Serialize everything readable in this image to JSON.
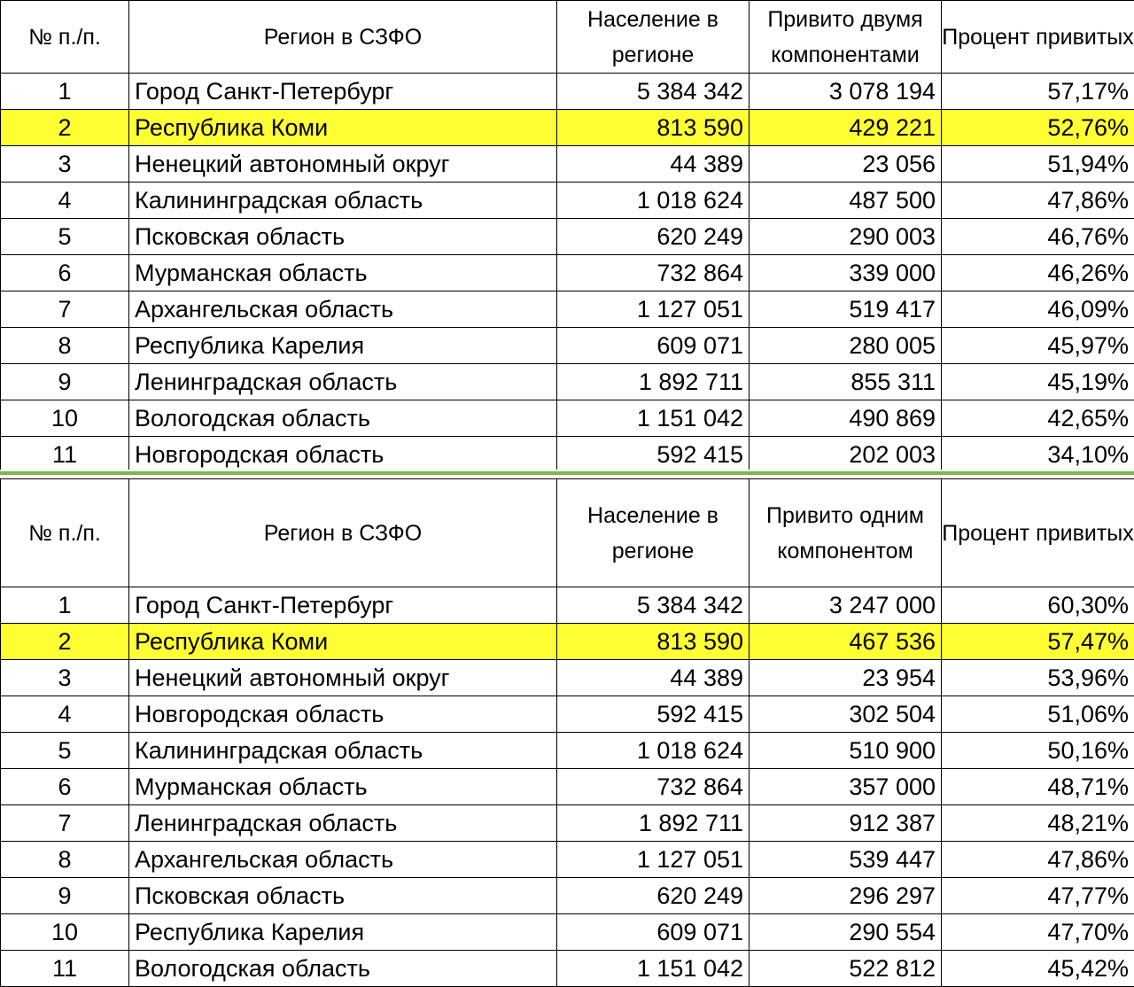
{
  "accent_highlight": "#ffff33",
  "divider_color": "#79b94a",
  "table_two_components": {
    "headers": {
      "num": "№ п./п.",
      "region": "Регион в СЗФО",
      "population": "Население в регионе",
      "vaccinated": "Привито двумя компонентами",
      "percent": "Процент привитых"
    },
    "rows": [
      {
        "num": "1",
        "region": "Город Санкт-Петербург",
        "population": "5 384 342",
        "vaccinated": "3 078 194",
        "percent": "57,17%"
      },
      {
        "num": "2",
        "region": "Республика Коми",
        "population": "813 590",
        "vaccinated": "429 221",
        "percent": "52,76%"
      },
      {
        "num": "3",
        "region": "Ненецкий автономный округ",
        "population": "44 389",
        "vaccinated": "23 056",
        "percent": "51,94%"
      },
      {
        "num": "4",
        "region": "Калининградская область",
        "population": "1 018 624",
        "vaccinated": "487 500",
        "percent": "47,86%"
      },
      {
        "num": "5",
        "region": "Псковская область",
        "population": "620 249",
        "vaccinated": "290 003",
        "percent": "46,76%"
      },
      {
        "num": "6",
        "region": "Мурманская область",
        "population": "732 864",
        "vaccinated": "339 000",
        "percent": "46,26%"
      },
      {
        "num": "7",
        "region": "Архангельская область",
        "population": "1 127 051",
        "vaccinated": "519 417",
        "percent": "46,09%"
      },
      {
        "num": "8",
        "region": "Республика Карелия",
        "population": "609 071",
        "vaccinated": "280 005",
        "percent": "45,97%"
      },
      {
        "num": "9",
        "region": "Ленинградская область",
        "population": "1 892 711",
        "vaccinated": "855 311",
        "percent": "45,19%"
      },
      {
        "num": "10",
        "region": "Вологодская область",
        "population": "1 151 042",
        "vaccinated": "490 869",
        "percent": "42,65%"
      },
      {
        "num": "11",
        "region": "Новгородская область",
        "population": "592 415",
        "vaccinated": "202 003",
        "percent": "34,10%"
      }
    ]
  },
  "table_one_component": {
    "headers": {
      "num": "№ п./п.",
      "region": "Регион в СЗФО",
      "population": "Население в регионе",
      "vaccinated": "Привито одним компонентом",
      "percent": "Процент привитых"
    },
    "rows": [
      {
        "num": "1",
        "region": "Город Санкт-Петербург",
        "population": "5 384 342",
        "vaccinated": "3 247 000",
        "percent": "60,30%"
      },
      {
        "num": "2",
        "region": "Республика Коми",
        "population": "813 590",
        "vaccinated": "467 536",
        "percent": "57,47%"
      },
      {
        "num": "3",
        "region": "Ненецкий автономный округ",
        "population": "44 389",
        "vaccinated": "23 954",
        "percent": "53,96%"
      },
      {
        "num": "4",
        "region": "Новгородская область",
        "population": "592 415",
        "vaccinated": "302 504",
        "percent": "51,06%"
      },
      {
        "num": "5",
        "region": "Калининградская область",
        "population": "1 018 624",
        "vaccinated": "510 900",
        "percent": "50,16%"
      },
      {
        "num": "6",
        "region": "Мурманская область",
        "population": "732 864",
        "vaccinated": "357 000",
        "percent": "48,71%"
      },
      {
        "num": "7",
        "region": "Ленинградская область",
        "population": "1 892 711",
        "vaccinated": "912 387",
        "percent": "48,21%"
      },
      {
        "num": "8",
        "region": "Архангельская область",
        "population": "1 127 051",
        "vaccinated": "539 447",
        "percent": "47,86%"
      },
      {
        "num": "9",
        "region": "Псковская область",
        "population": "620 249",
        "vaccinated": "296 297",
        "percent": "47,77%"
      },
      {
        "num": "10",
        "region": "Республика Карелия",
        "population": "609 071",
        "vaccinated": "290 554",
        "percent": "47,70%"
      },
      {
        "num": "11",
        "region": "Вологодская область",
        "population": "1 151 042",
        "vaccinated": "522 812",
        "percent": "45,42%"
      }
    ]
  }
}
